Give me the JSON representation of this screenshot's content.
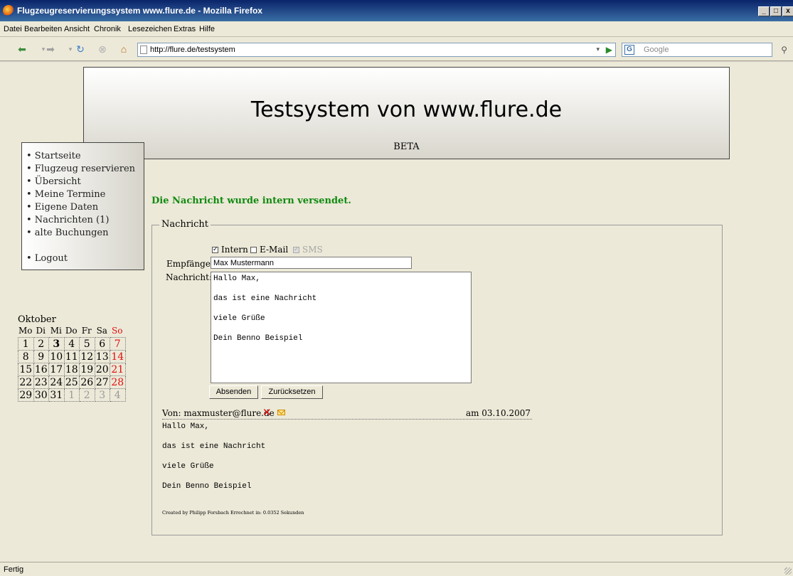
{
  "window": {
    "title": "Flugzeugreservierungssystem www.flure.de - Mozilla Firefox",
    "controls": [
      "_",
      "□",
      "x"
    ]
  },
  "menu": [
    "Datei",
    "Bearbeiten",
    "Ansicht",
    "Chronik",
    "Lesezeichen",
    "Extras",
    "Hilfe"
  ],
  "toolbar": {
    "url": "http://flure.de/testsystem",
    "search_placeholder": "Google",
    "search_engine_letter": "G"
  },
  "header": {
    "title": "Testsystem von www.flure.de",
    "subtitle": "BETA"
  },
  "nav": {
    "items": [
      "• Startseite",
      "• Flugzeug reservieren",
      "• Übersicht",
      "• Meine Termine",
      "• Eigene Daten",
      "• Nachrichten (1)",
      "• alte Buchungen"
    ],
    "logout": "• Logout"
  },
  "calendar": {
    "month": "Oktober",
    "weekdays": [
      "Mo",
      "Di",
      "Mi",
      "Do",
      "Fr",
      "Sa",
      "So"
    ],
    "weeks": [
      [
        1,
        2,
        3,
        4,
        5,
        6,
        7
      ],
      [
        8,
        9,
        10,
        11,
        12,
        13,
        14
      ],
      [
        15,
        16,
        17,
        18,
        19,
        20,
        21
      ],
      [
        22,
        23,
        24,
        25,
        26,
        27,
        28
      ],
      [
        29,
        30,
        31,
        1,
        2,
        3,
        4
      ]
    ],
    "today": 3,
    "sunday_color": "#e01010"
  },
  "main": {
    "success": "Die Nachricht wurde intern versendet.",
    "legend": "Nachricht",
    "options": {
      "intern": {
        "label": "Intern",
        "checked": true
      },
      "email": {
        "label": "E-Mail",
        "checked": false
      },
      "sms": {
        "label": "SMS",
        "checked": true,
        "disabled": true
      }
    },
    "recipient_label": "Empfänger:",
    "recipient_value": "Max Mustermann",
    "message_label": "Nachricht:",
    "message_text": "Hallo Max,\n\ndas ist eine Nachricht\n\nviele Grüße\n\nDein Benno Beispiel",
    "send_label": "Absenden",
    "reset_label": "Zurücksetzen"
  },
  "received": {
    "from": "Von: maxmuster@flure.de",
    "date": "am 03.10.2007",
    "body": "Hallo Max,\n\ndas ist eine Nachricht\n\nviele Grüße\n\nDein Benno Beispiel"
  },
  "footer": "Created by Philipp Forsbach    Errechnet in: 0.0352 Sekunden",
  "status": "Fertig",
  "colors": {
    "success": "#118a11",
    "delete_icon": "#e01010"
  }
}
